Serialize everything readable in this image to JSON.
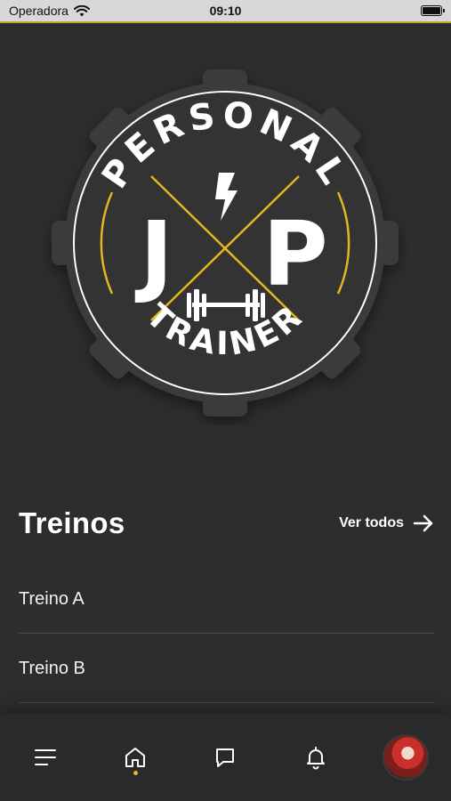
{
  "status_bar": {
    "carrier": "Operadora",
    "time": "09:10"
  },
  "logo": {
    "top_text": "PERSONAL",
    "letter_left": "J",
    "letter_right": "P",
    "bottom_text": "TRAINER",
    "accent": "#e4b71f"
  },
  "section": {
    "title": "Treinos",
    "see_all": "Ver todos"
  },
  "workouts": [
    {
      "label": "Treino A"
    },
    {
      "label": "Treino B"
    }
  ],
  "tab_bar": {
    "items": [
      {
        "icon": "menu-icon"
      },
      {
        "icon": "home-icon",
        "active": true
      },
      {
        "icon": "chat-icon"
      },
      {
        "icon": "bell-icon"
      },
      {
        "icon": "avatar"
      }
    ]
  },
  "colors": {
    "background": "#2d2d2d",
    "accent": "#e4b71f",
    "text": "#ffffff"
  }
}
